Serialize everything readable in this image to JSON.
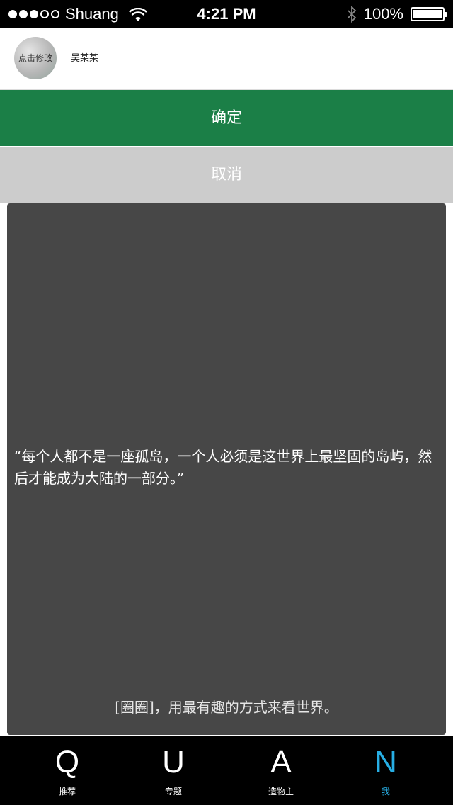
{
  "status_bar": {
    "carrier": "Shuang",
    "time": "4:21 PM",
    "battery": "100%"
  },
  "profile": {
    "avatar_caption": "点击修改",
    "name": "吴某某"
  },
  "actions": {
    "confirm_label": "确定",
    "cancel_label": "取消"
  },
  "quote": {
    "text": "“每个人都不是一座孤岛，一个人必须是这世界上最坚固的岛屿，然后才能成为大陆的一部分。”",
    "slogan": "[圈圈]，用最有趣的方式来看世界。"
  },
  "tab_bar": {
    "tabs": [
      {
        "letter": "Q",
        "label": "推荐"
      },
      {
        "letter": "U",
        "label": "专题"
      },
      {
        "letter": "A",
        "label": "造物主"
      },
      {
        "letter": "N",
        "label": "我"
      }
    ],
    "active_index": 3
  },
  "colors": {
    "confirm": "#1b7f47",
    "cancel": "#cccccc",
    "panel": "#474747",
    "active_tab": "#27aee4"
  }
}
